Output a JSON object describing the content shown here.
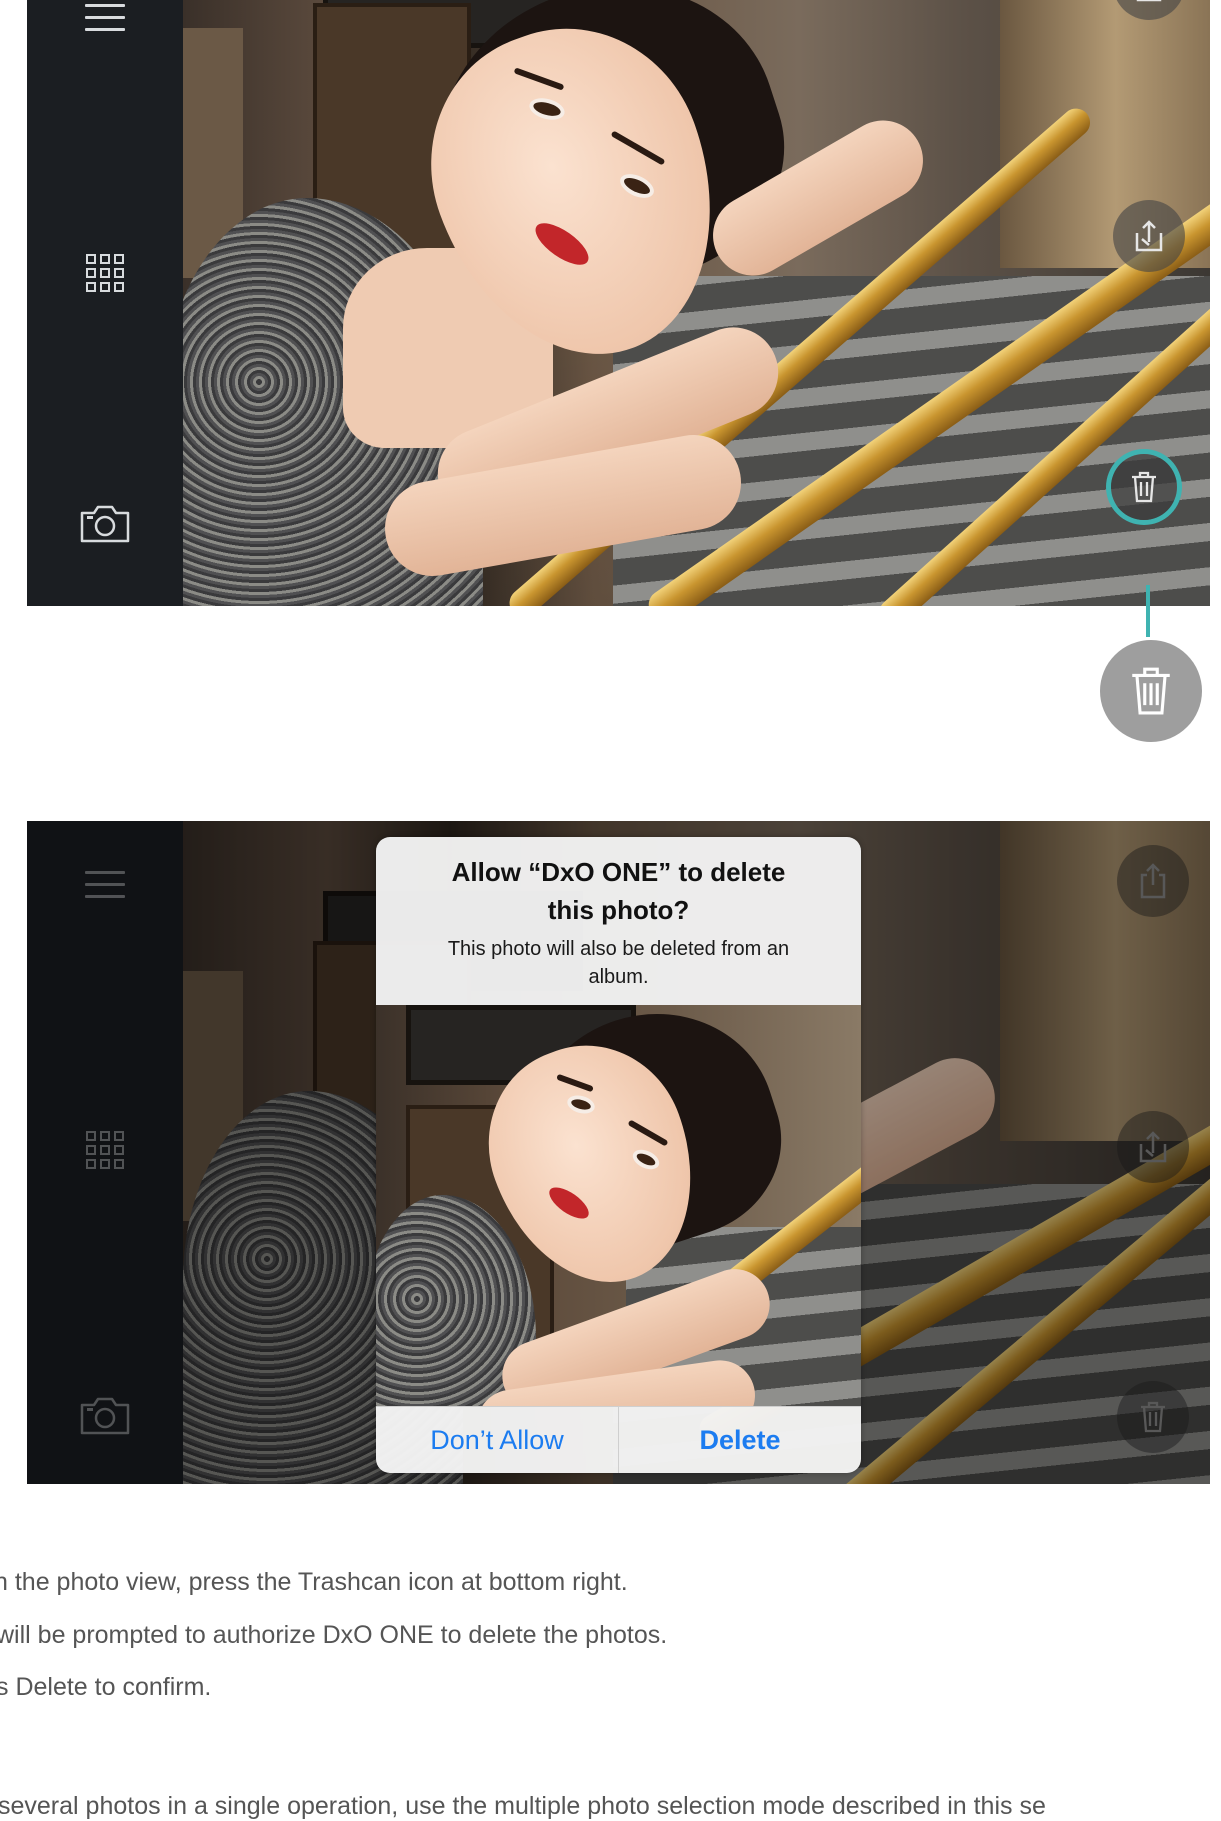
{
  "sidebar": {
    "menu_icon": "hamburger-menu-icon",
    "grid_icon": "grid-gallery-icon",
    "camera_icon": "camera-icon"
  },
  "actions": {
    "share_icon": "share-icon",
    "export_icon": "export-icon",
    "trash_icon": "trash-icon"
  },
  "colors": {
    "highlight": "#3fb3b1",
    "alert_button": "#1c7cf0",
    "sidebar": "#1b1e22"
  },
  "dialog": {
    "title_line1": "Allow “DxO ONE” to delete",
    "title_line2": "this photo?",
    "message_line1": "This photo will also be deleted from an",
    "message_line2": "album.",
    "cancel_label": "Don’t Allow",
    "confirm_label": "Delete"
  },
  "instructions": [
    "n the photo view, press the Trashcan icon at bottom right.",
    "will be prompted to authorize DxO ONE to delete the photos.",
    "s Delete to confirm.",
    "several photos in a single operation, use the multiple photo selection mode described in this se"
  ]
}
